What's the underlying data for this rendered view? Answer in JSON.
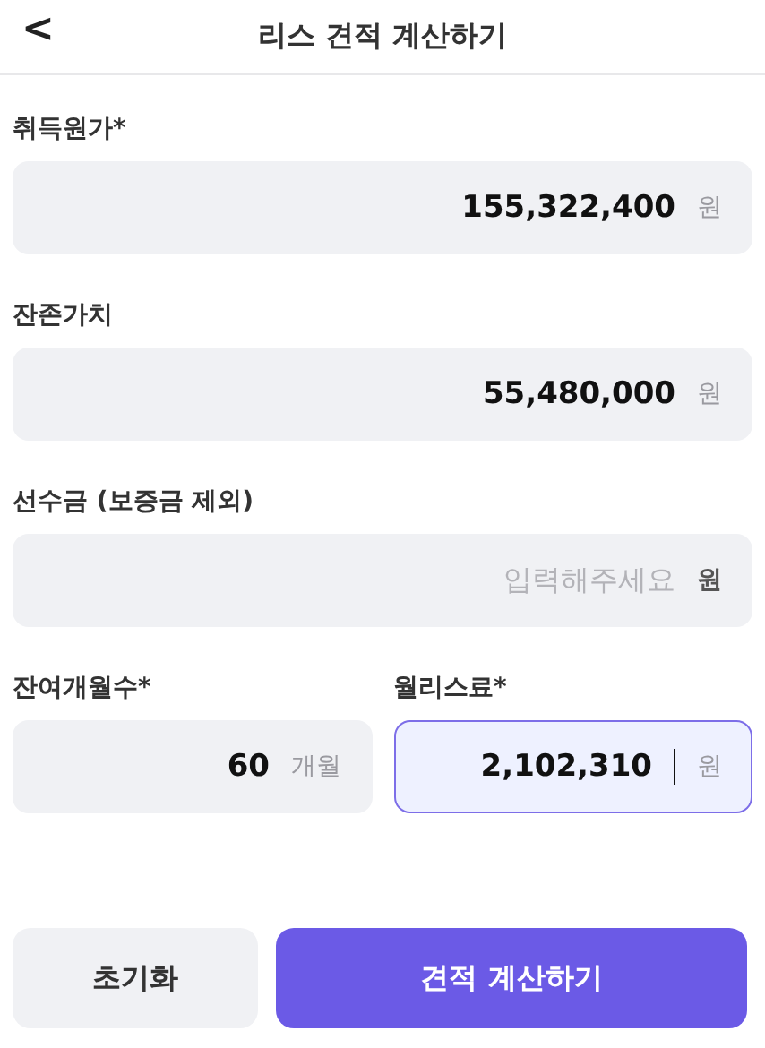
{
  "header": {
    "back": "<",
    "title": "리스 견적 계산하기"
  },
  "rows": [
    [
      {
        "label": "취득원가*",
        "value": "155,322,400",
        "unit": "원",
        "focused": false
      }
    ],
    [
      {
        "label": "잔존가치",
        "value": "55,480,000",
        "unit": "원",
        "focused": false
      }
    ],
    [
      {
        "label": "선수금 (보증금 제외)",
        "placeholder": "입력해주세요",
        "unit": "원",
        "focused": false
      }
    ],
    [
      {
        "label": "잔여개월수*",
        "value": "60",
        "unit": "개월",
        "focused": false
      },
      {
        "label": "월리스료*",
        "value": "2,102,310",
        "unit": "원",
        "focused": true
      }
    ]
  ],
  "buttons": [
    {
      "label": "초기화",
      "kind": "secondary"
    },
    {
      "label": "견적 계산하기",
      "kind": "primary"
    }
  ]
}
